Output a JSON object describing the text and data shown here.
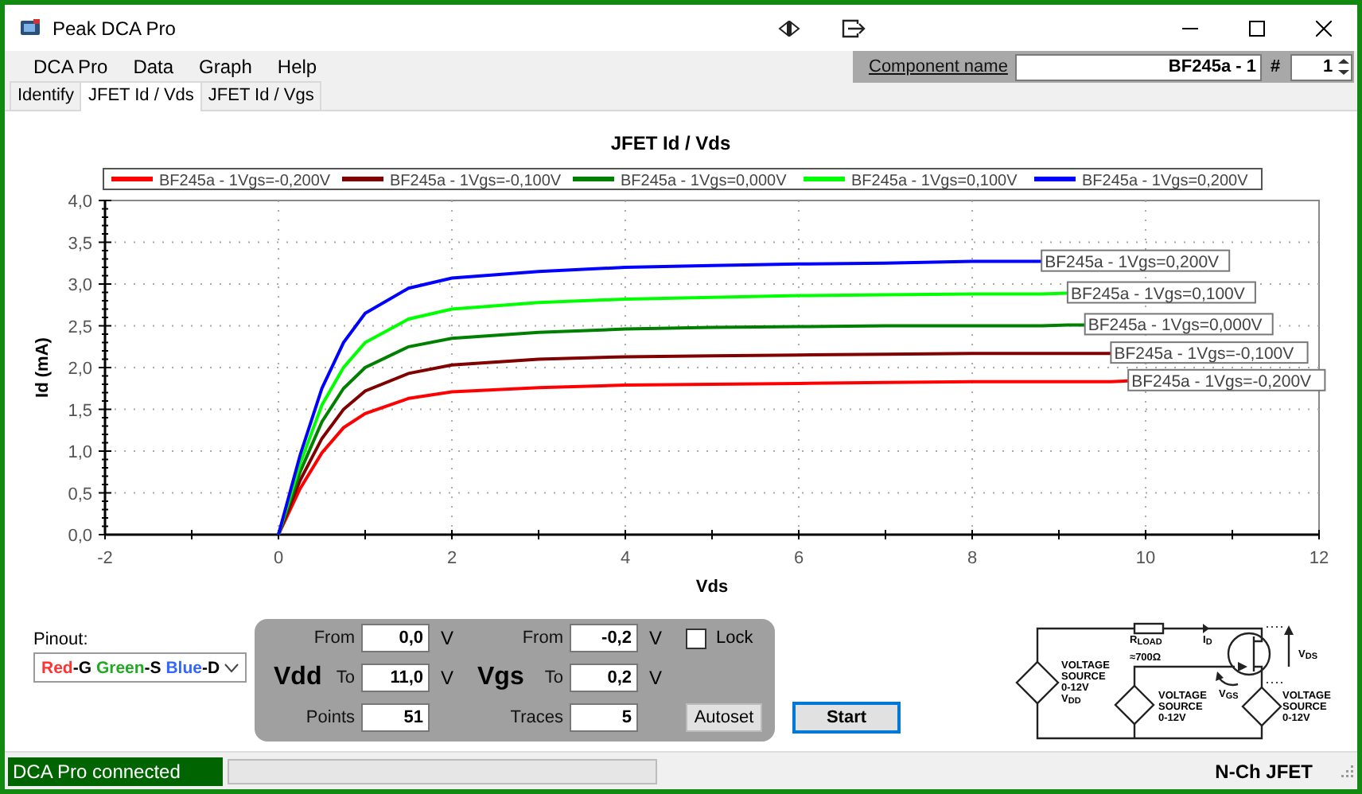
{
  "window": {
    "title": "Peak DCA Pro"
  },
  "menu": [
    "DCA Pro",
    "Data",
    "Graph",
    "Help"
  ],
  "component": {
    "label": "Component name",
    "value": "BF245a - 1",
    "number_label": "#",
    "number": "1"
  },
  "tabs": [
    {
      "label": "Identify",
      "selected": false
    },
    {
      "label": "JFET Id / Vds",
      "selected": true
    },
    {
      "label": "JFET Id / Vgs",
      "selected": false
    }
  ],
  "chart": {
    "chart_data": {
      "type": "line",
      "title": "JFET Id / Vds",
      "xlabel": "Vds",
      "ylabel": "Id (mA)",
      "x": [
        0,
        0.25,
        0.5,
        0.75,
        1,
        1.5,
        2,
        3,
        4,
        5,
        6,
        7,
        8,
        8.8,
        9.1,
        9.3,
        9.6,
        9.8
      ],
      "series": [
        {
          "name": "BF245a - 1Vgs=-0,200V",
          "color": "#ff0000",
          "values": [
            0,
            0.55,
            0.98,
            1.28,
            1.45,
            1.63,
            1.71,
            1.76,
            1.79,
            1.8,
            1.81,
            1.82,
            1.83,
            1.83,
            1.83,
            1.83,
            1.83,
            1.84
          ]
        },
        {
          "name": "BF245a - 1Vgs=-0,100V",
          "color": "#800000",
          "values": [
            0,
            0.65,
            1.15,
            1.5,
            1.72,
            1.93,
            2.03,
            2.1,
            2.13,
            2.14,
            2.15,
            2.16,
            2.17,
            2.17,
            2.17,
            2.17,
            2.17,
            null
          ]
        },
        {
          "name": "BF245a - 1Vgs=0,000V",
          "color": "#008000",
          "values": [
            0,
            0.75,
            1.35,
            1.75,
            2.0,
            2.25,
            2.35,
            2.42,
            2.46,
            2.48,
            2.49,
            2.5,
            2.5,
            2.5,
            2.51,
            2.51,
            null,
            null
          ]
        },
        {
          "name": "BF245a - 1Vgs=0,100V",
          "color": "#00ff00",
          "values": [
            0,
            0.85,
            1.55,
            2.0,
            2.3,
            2.58,
            2.7,
            2.78,
            2.82,
            2.84,
            2.86,
            2.87,
            2.88,
            2.88,
            2.89,
            null,
            null,
            null
          ]
        },
        {
          "name": "BF245a - 1Vgs=0,200V",
          "color": "#0000ff",
          "values": [
            0,
            0.95,
            1.75,
            2.3,
            2.65,
            2.95,
            3.07,
            3.15,
            3.2,
            3.22,
            3.24,
            3.25,
            3.27,
            3.27,
            null,
            null,
            null,
            null
          ]
        }
      ],
      "xlim": [
        -2,
        12
      ],
      "ylim": [
        0,
        4
      ],
      "xticks": [
        -2,
        0,
        2,
        4,
        6,
        8,
        10,
        12
      ],
      "yticks": [
        {
          "value": 0,
          "label": "0,0"
        },
        {
          "value": 0.5,
          "label": "0,5"
        },
        {
          "value": 1,
          "label": "1,0"
        },
        {
          "value": 1.5,
          "label": "1,5"
        },
        {
          "value": 2,
          "label": "2,0"
        },
        {
          "value": 2.5,
          "label": "2,5"
        },
        {
          "value": 3,
          "label": "3,0"
        },
        {
          "value": 3.5,
          "label": "3,5"
        },
        {
          "value": 4,
          "label": "4,0"
        }
      ],
      "grid": true,
      "legend": true,
      "annotations": [
        {
          "x": 9.8,
          "y": 1.84,
          "text": "BF245a - 1Vgs=-0,200V"
        },
        {
          "x": 9.6,
          "y": 2.17,
          "text": "BF245a - 1Vgs=-0,100V"
        },
        {
          "x": 9.3,
          "y": 2.51,
          "text": "BF245a - 1Vgs=0,000V"
        },
        {
          "x": 9.1,
          "y": 2.89,
          "text": "BF245a - 1Vgs=0,100V"
        },
        {
          "x": 8.8,
          "y": 3.27,
          "text": "BF245a - 1Vgs=0,200V"
        }
      ]
    }
  },
  "pinout": {
    "label": "Pinout:",
    "segments": [
      {
        "color_word": "Red",
        "color": "#ff3333",
        "pin": "-G"
      },
      {
        "color_word": "Green",
        "color": "#22aa22",
        "pin": "-S"
      },
      {
        "color_word": "Blue",
        "color": "#3366ff",
        "pin": "-D"
      }
    ]
  },
  "vdd": {
    "label": "Vdd",
    "from_label": "From",
    "from": "0,0",
    "from_unit": "V",
    "to_label": "To",
    "to": "11,0",
    "to_unit": "V",
    "points_label": "Points",
    "points": "51"
  },
  "vgs": {
    "label": "Vgs",
    "from_label": "From",
    "from": "-0,2",
    "from_unit": "V",
    "to_label": "To",
    "to": "0,2",
    "to_unit": "V",
    "traces_label": "Traces",
    "traces": "5"
  },
  "lock": {
    "label": "Lock",
    "checked": false
  },
  "autoset_button": "Autoset",
  "start_button": "Start",
  "circuit": {
    "labels": [
      "R$_{LOAD}$",
      "≈700Ω",
      "I$_{D}$",
      "V$_{DS}$",
      "V$_{GS}$"
    ],
    "sources": [
      {
        "lines": [
          "VOLTAGE",
          "SOURCE",
          "0-12V",
          "V$_{DD}$"
        ]
      },
      {
        "lines": [
          "VOLTAGE",
          "SOURCE",
          "0-12V"
        ]
      },
      {
        "lines": [
          "VOLTAGE",
          "SOURCE",
          "0-12V"
        ]
      }
    ]
  },
  "status_bar": {
    "connection": "DCA Pro connected",
    "progress": {
      "level": 0
    },
    "device_type": "N-Ch JFET"
  }
}
